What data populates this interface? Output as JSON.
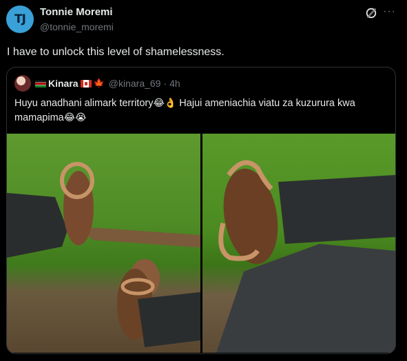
{
  "post": {
    "author_name": "Tonnie Moremi",
    "author_handle": "@tonnie_moremi",
    "avatar_initials": "TJ",
    "text": "I have to unlock this level of shamelessness.",
    "more_label": "···"
  },
  "quote": {
    "name": "Kinara",
    "handle": "@kinara_69",
    "separator": "·",
    "time": "4h",
    "text_part1": "Huyu anadhani alimark territory",
    "emoji_1": "😂👌",
    "text_part2": " Hajui ameniachia viatu za kuzurura kwa mamapima",
    "emoji_2": "😂😭"
  },
  "icons": {
    "grok": "grok-icon",
    "more": "more-icon"
  },
  "colors": {
    "background": "#000000",
    "text": "#e7e9ea",
    "muted": "#71767b",
    "border": "#2f3336",
    "avatar": "#3aa0d8"
  }
}
